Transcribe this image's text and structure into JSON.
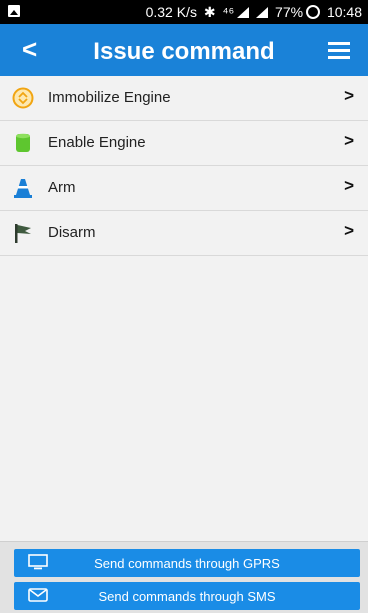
{
  "status_bar": {
    "speed": "0.32 K/s",
    "network": "⁴⁶",
    "battery": "77%",
    "time": "10:48"
  },
  "app_bar": {
    "title": "Issue command"
  },
  "commands": [
    {
      "label": "Immobilize  Engine"
    },
    {
      "label": "Enable Engine"
    },
    {
      "label": "Arm"
    },
    {
      "label": "Disarm"
    }
  ],
  "chevron": ">",
  "back_glyph": "<",
  "actions": {
    "gprs_label": "Send commands through GPRS",
    "sms_label": "Send commands through SMS"
  },
  "colors": {
    "primary": "#1a82d8",
    "button": "#1a8ce6"
  }
}
